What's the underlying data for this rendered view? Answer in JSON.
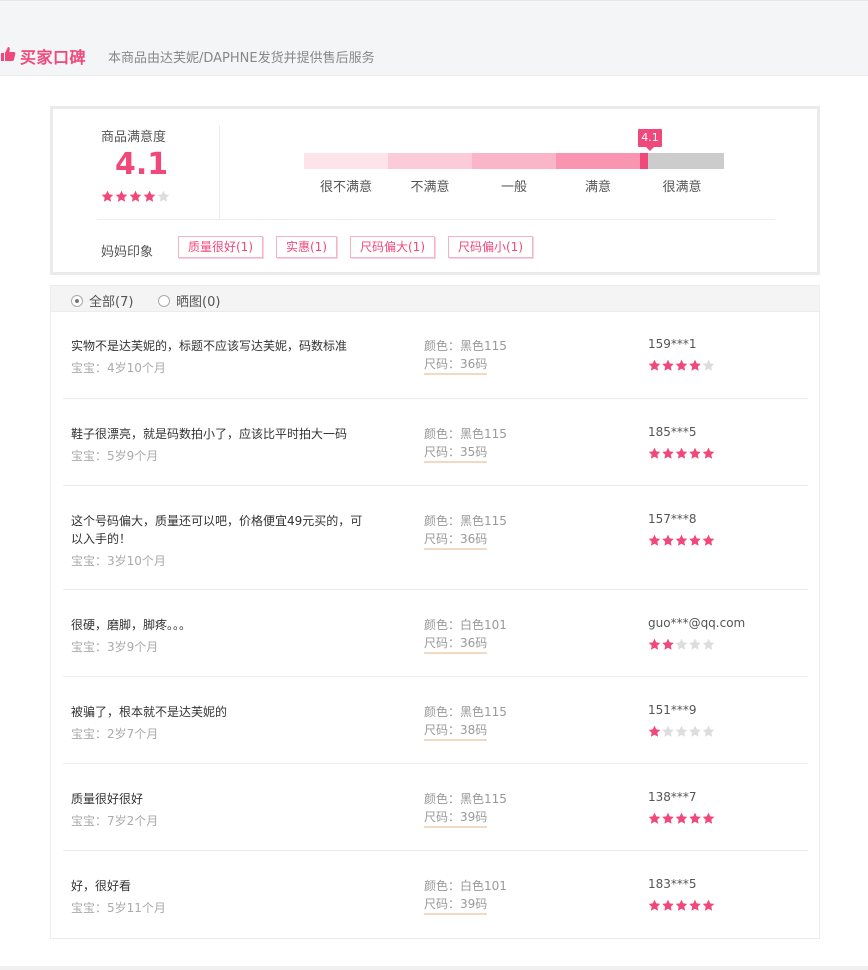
{
  "header": {
    "title": "买家口碑",
    "subtitle": "本商品由达芙妮/DAPHNE发货并提供售后服务"
  },
  "summary": {
    "satisfaction_label": "商品满意度",
    "score": "4.1",
    "stars": 4,
    "bar_labels": [
      "很不满意",
      "不满意",
      "一般",
      "满意",
      "很满意"
    ],
    "bar_colors": [
      "#fde3ea",
      "#fccbd9",
      "#fbb5c8",
      "#f995b0",
      "#cccccc"
    ],
    "marker_value": "4.1",
    "impression_label": "妈妈印象",
    "tags": [
      "质量很好(1)",
      "实惠(1)",
      "尺码偏大(1)",
      "尺码偏小(1)"
    ]
  },
  "filters": {
    "all_label": "全部(7)",
    "photo_label": "晒图(0)",
    "selected": "all"
  },
  "colors": {
    "accent": "#f0487a",
    "star_empty": "#dddddd"
  },
  "reviews": [
    {
      "text": "实物不是达芙妮的，标题不应该写达芙妮，码数标准",
      "baby": "宝宝：4岁10个月",
      "color": "颜色：黑色115",
      "size": "尺码：36码",
      "user": "159***1",
      "stars": 4
    },
    {
      "text": "鞋子很漂亮，就是码数拍小了，应该比平时拍大一码",
      "baby": "宝宝：5岁9个月",
      "color": "颜色：黑色115",
      "size": "尺码：35码",
      "user": "185***5",
      "stars": 5
    },
    {
      "text": "这个号码偏大，质量还可以吧，价格便宜49元买的，可以入手的！",
      "baby": "宝宝：3岁10个月",
      "color": "颜色：黑色115",
      "size": "尺码：36码",
      "user": "157***8",
      "stars": 5
    },
    {
      "text": "很硬，磨脚，脚疼。。。",
      "baby": "宝宝：3岁9个月",
      "color": "颜色：白色101",
      "size": "尺码：36码",
      "user": "guo***@qq.com",
      "stars": 2
    },
    {
      "text": "被骗了，根本就不是达芙妮的",
      "baby": "宝宝：2岁7个月",
      "color": "颜色：黑色115",
      "size": "尺码：38码",
      "user": "151***9",
      "stars": 1
    },
    {
      "text": "质量很好很好",
      "baby": "宝宝：7岁2个月",
      "color": "颜色：黑色115",
      "size": "尺码：39码",
      "user": "138***7",
      "stars": 5
    },
    {
      "text": "好，很好看",
      "baby": "宝宝：5岁11个月",
      "color": "颜色：白色101",
      "size": "尺码：39码",
      "user": "183***5",
      "stars": 5
    }
  ]
}
